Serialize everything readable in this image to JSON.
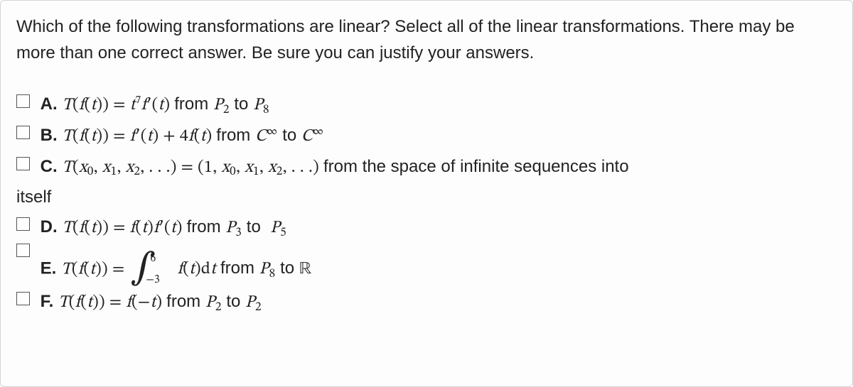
{
  "question": {
    "stem": "Which of the following transformations are linear? Select all of the linear transformations. There may be more than one correct answer. Be sure you can justify your answers."
  },
  "options": {
    "a": {
      "label": "A.",
      "from_word": "from",
      "set_from": "P",
      "set_from_sub": "2",
      "to_word": "to",
      "set_to": "P",
      "set_to_sub": "8",
      "exponent": "7"
    },
    "b": {
      "label": "B.",
      "from_word": "from",
      "coeff": "4",
      "sym_inf": "∞"
    },
    "c": {
      "label": "C.",
      "seq_left_lead": "1",
      "tail_text": "from the space of infinite sequences into",
      "itself": "itself"
    },
    "d": {
      "label": "D.",
      "from_word": "from",
      "set_from": "P",
      "set_from_sub": "3",
      "to_word": "to",
      "set_to": "P",
      "set_to_sub": "5"
    },
    "e": {
      "label": "E.",
      "int_low": "−3",
      "int_up": "6",
      "from_word": "from",
      "set_from": "P",
      "set_from_sub": "8",
      "to_word": "to",
      "set_to": "ℝ"
    },
    "f": {
      "label": "F.",
      "from_word": "from",
      "set_from": "P",
      "set_from_sub": "2",
      "to_word": "to",
      "set_to": "P",
      "set_to_sub": "2"
    }
  },
  "sym": {
    "to": "to"
  }
}
